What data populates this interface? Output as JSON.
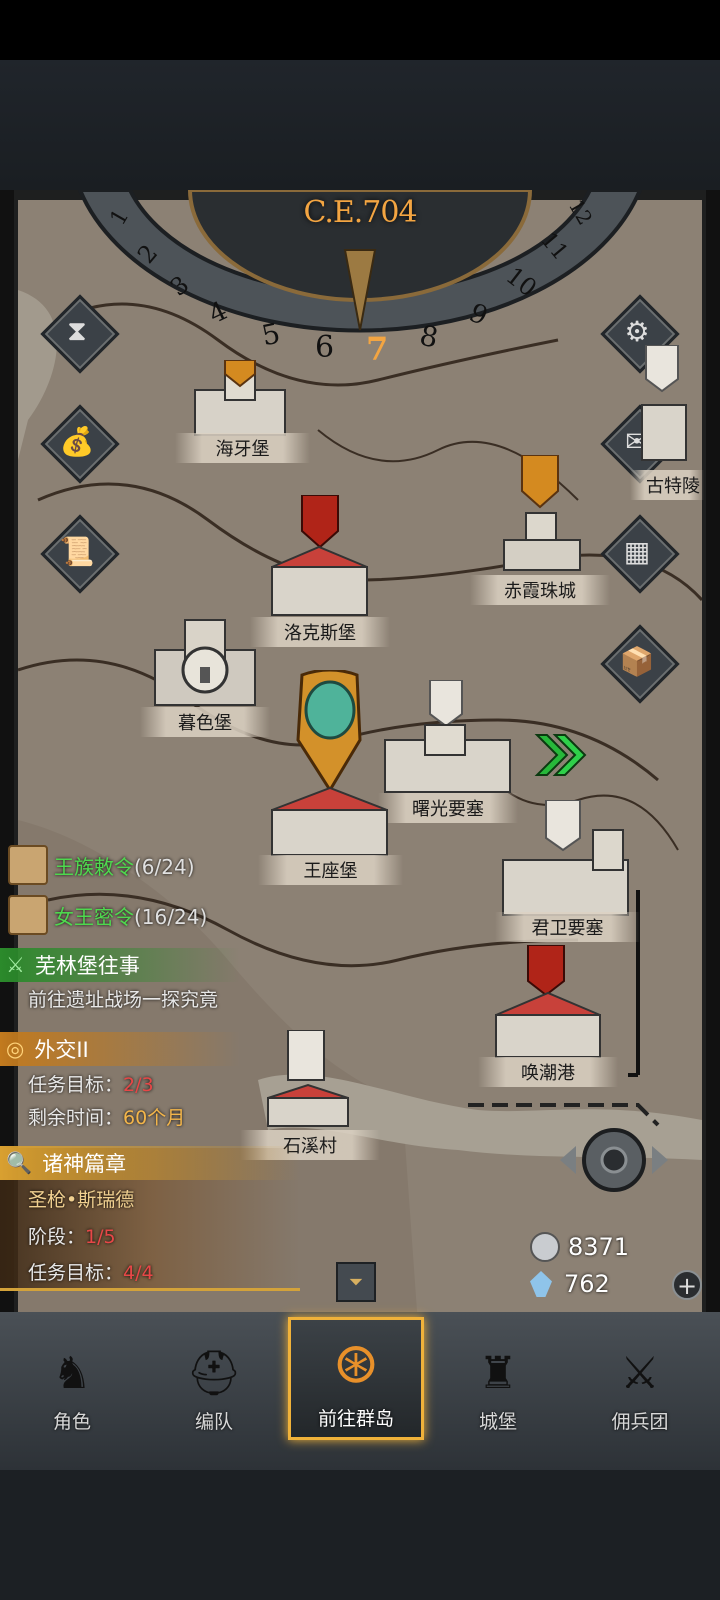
{
  "era": {
    "label": "C.E.704"
  },
  "dial": {
    "months": [
      "1",
      "2",
      "3",
      "4",
      "5",
      "6",
      "7",
      "8",
      "9",
      "10",
      "11",
      "12"
    ],
    "current": "7"
  },
  "locations": {
    "haiya": "海牙堡",
    "luokesi": "洛克斯堡",
    "chixia": "赤霞珠城",
    "muse": "暮色堡",
    "shuguang": "曙光要塞",
    "wangzuo": "王座堡",
    "junwei": "君卫要塞",
    "huanchao": "唤潮港",
    "shixi": "石溪村",
    "gute": "古特陵"
  },
  "quests": {
    "royal_decree": {
      "title": "王族敕令",
      "count": "(6/24)"
    },
    "queen_secret": {
      "title": "女王密令",
      "count": "(16/24)"
    }
  },
  "tasks": {
    "story": {
      "title": "芜林堡往事",
      "desc": "前往遗址战场一探究竟"
    },
    "diplomacy": {
      "title": "外交II",
      "goal_label": "任务目标：",
      "goal_value": "2/3",
      "time_label": "剩余时间：",
      "time_value": "60个月"
    },
    "gods": {
      "title": "诸神篇章",
      "hero": "圣枪•斯瑞德",
      "stage_label": "阶段：",
      "stage_value": "1/5",
      "goal_label": "任务目标：",
      "goal_value": "4/4"
    }
  },
  "resources": {
    "silver": "8371",
    "crystal": "762"
  },
  "tabs": [
    {
      "label": "角色"
    },
    {
      "label": "编队"
    },
    {
      "label": "前往群岛"
    },
    {
      "label": "城堡"
    },
    {
      "label": "佣兵团"
    }
  ],
  "colors": {
    "accent_orange": "#f3a542",
    "quest_green": "#4ed84e",
    "progress_red": "#e74747",
    "active_tab_border": "#f0b23a"
  }
}
